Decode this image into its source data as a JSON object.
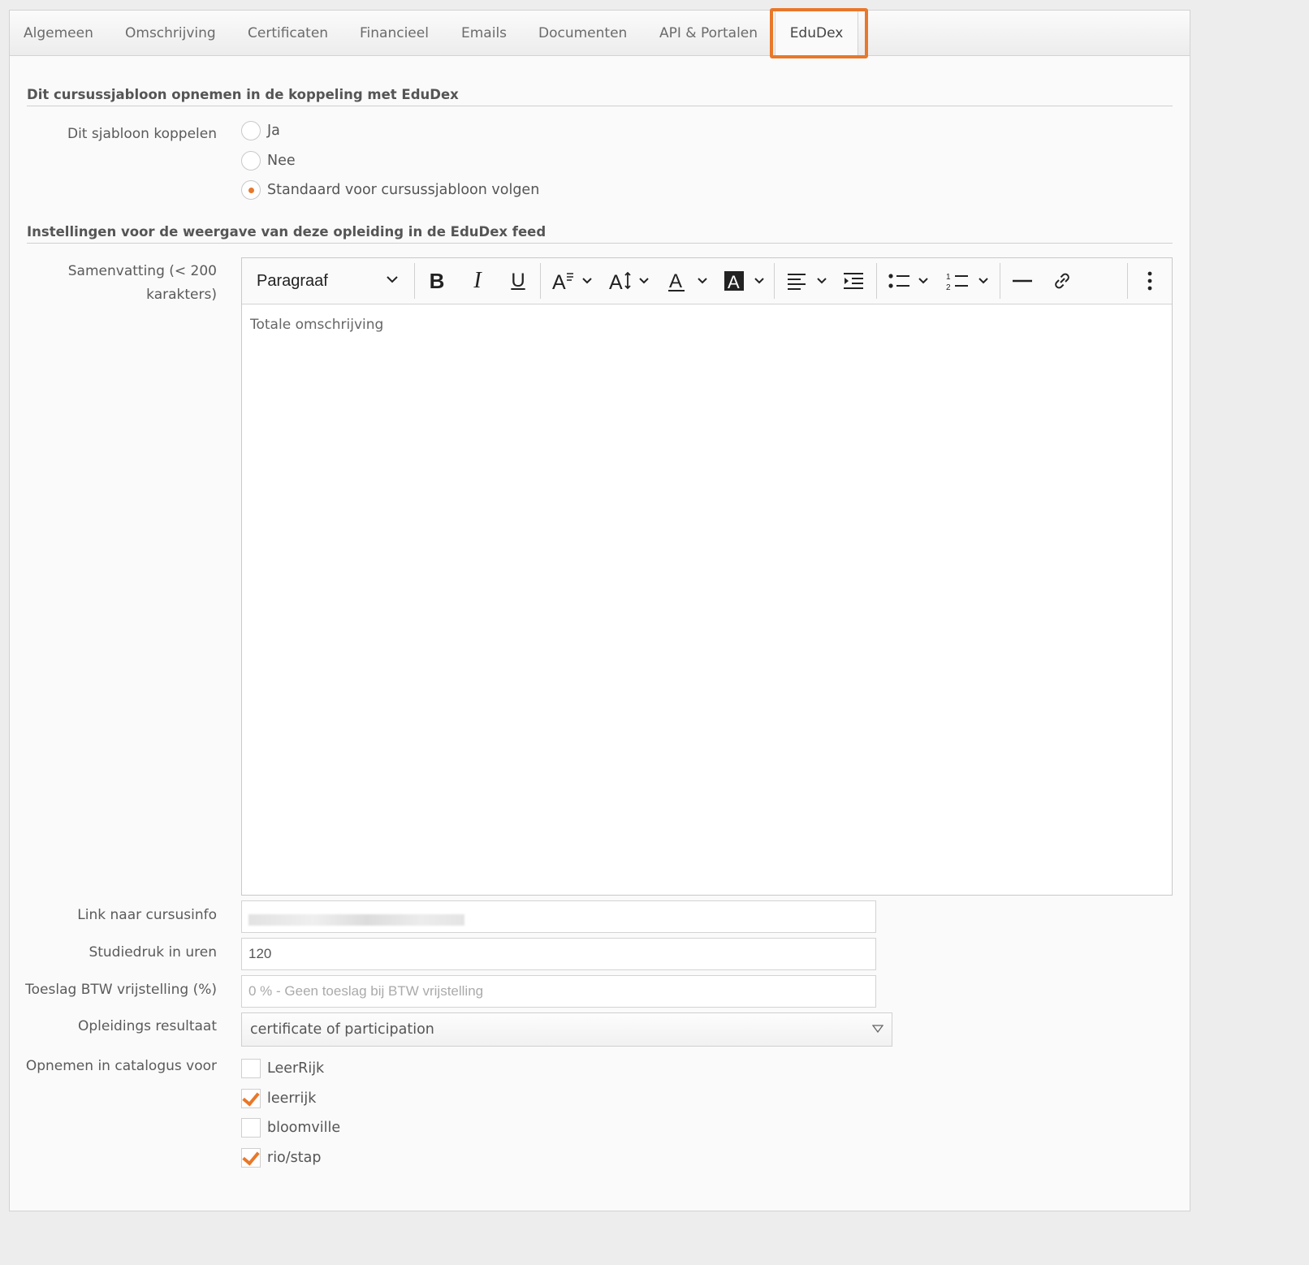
{
  "tabs": [
    {
      "label": "Algemeen"
    },
    {
      "label": "Omschrijving"
    },
    {
      "label": "Certificaten"
    },
    {
      "label": "Financieel"
    },
    {
      "label": "Emails"
    },
    {
      "label": "Documenten"
    },
    {
      "label": "API & Portalen"
    },
    {
      "label": "EduDex"
    }
  ],
  "active_tab": "EduDex",
  "accent_color": "#e8782a",
  "section1": {
    "title": "Dit cursussjabloon opnemen in de koppeling met EduDex",
    "field_label": "Dit sjabloon koppelen",
    "options": [
      {
        "label": "Ja",
        "selected": false
      },
      {
        "label": "Nee",
        "selected": false
      },
      {
        "label": "Standaard voor cursussjabloon volgen",
        "selected": true
      }
    ]
  },
  "section2": {
    "title": "Instellingen voor de weergave van deze opleiding in de EduDex feed",
    "summary_label_line1": "Samenvatting (< 200",
    "summary_label_line2": "karakters)",
    "editor": {
      "block_format": "Paragraaf",
      "content": "Totale omschrijving",
      "toolbar_icons": [
        "bold-icon",
        "italic-icon",
        "underline-icon",
        "font-family-icon",
        "font-size-icon",
        "font-color-icon",
        "highlight-icon",
        "align-icon",
        "indent-icon",
        "bullet-list-icon",
        "numbered-list-icon",
        "horizontal-line-icon",
        "link-icon",
        "more-icon"
      ]
    },
    "link_label": "Link naar cursusinfo",
    "link_value": "",
    "study_label": "Studiedruk in uren",
    "study_value": "120",
    "vat_label": "Toeslag BTW vrijstelling (%)",
    "vat_placeholder": "0 % - Geen toeslag bij BTW vrijstelling",
    "result_label": "Opleidings resultaat",
    "result_value": "certificate of participation",
    "catalog_label": "Opnemen in catalogus voor",
    "catalogs": [
      {
        "label": "LeerRijk",
        "checked": false
      },
      {
        "label": "leerrijk",
        "checked": true
      },
      {
        "label": "bloomville",
        "checked": false
      },
      {
        "label": "rio/stap",
        "checked": true
      }
    ]
  }
}
